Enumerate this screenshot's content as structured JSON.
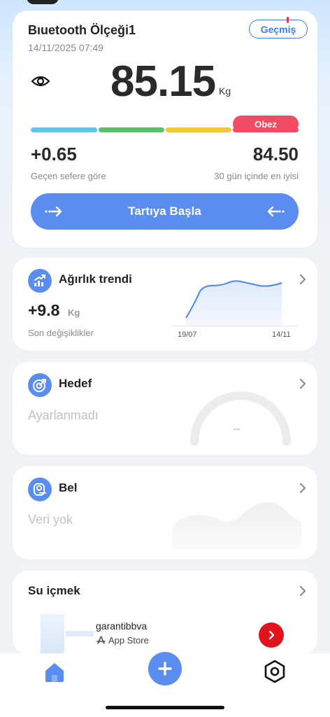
{
  "scale_card": {
    "device_name": "Bıuetooth Ölçeği1",
    "timestamp": "14/11/2025 07:49",
    "history_label": "Geçmiş",
    "weight_value": "85.15",
    "weight_unit": "Kg",
    "bmi_label": "Obez",
    "bmi_colors": [
      "#5ec5ef",
      "#58c26a",
      "#f5c341",
      "#f04c63"
    ],
    "change_value": "+0.65",
    "change_label": "Geçen sefere göre",
    "best_value": "84.50",
    "best_label": "30 gün içinde en iyisi",
    "start_button_label": "Tartıya Başla"
  },
  "trend_card": {
    "title": "Ağırlık trendi",
    "value": "+9.8",
    "unit": "Kg",
    "subtitle": "Son değişiklikler",
    "x_start": "19/07",
    "x_end": "14/11"
  },
  "goal_card": {
    "title": "Hedef",
    "status": "Ayarlanmadı",
    "gauge_value": "--"
  },
  "waist_card": {
    "title": "Bel",
    "status": "Veri yok"
  },
  "water_card": {
    "title": "Su içmek"
  },
  "ad": {
    "advertiser": "garantibbva",
    "store": "App Store"
  },
  "colors": {
    "accent": "#5b8def",
    "danger": "#f04c63"
  }
}
